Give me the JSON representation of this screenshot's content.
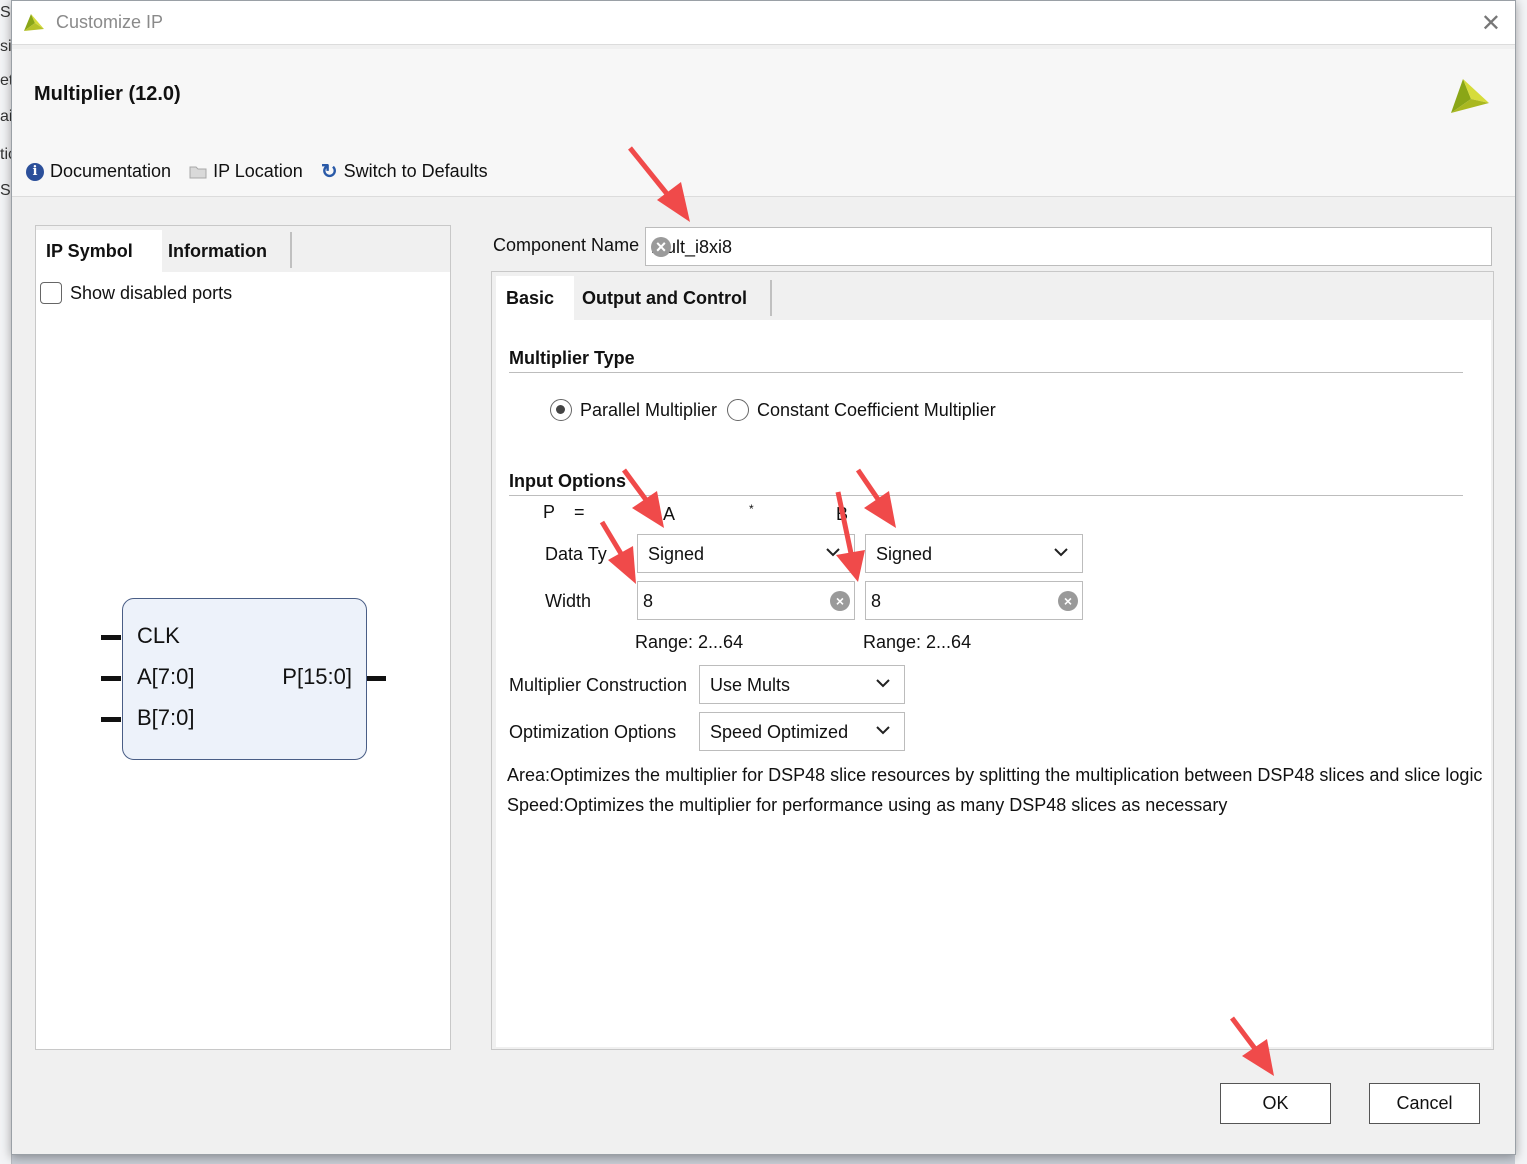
{
  "window": {
    "title": "Customize IP"
  },
  "header": {
    "heading": "Multiplier (12.0)",
    "toolbar": {
      "documentation": "Documentation",
      "ip_location": "IP Location",
      "switch_defaults": "Switch to Defaults"
    }
  },
  "left_panel": {
    "tabs": [
      "IP Symbol",
      "Information"
    ],
    "show_disabled_ports": "Show disabled ports",
    "symbol": {
      "inputs": [
        "CLK",
        "A[7:0]",
        "B[7:0]"
      ],
      "output": "P[15:0]"
    }
  },
  "component": {
    "label": "Component Name",
    "value": "mult_i8xi8"
  },
  "right_panel": {
    "tabs": [
      "Basic",
      "Output and Control"
    ],
    "multiplier_type": {
      "title": "Multiplier Type",
      "options": [
        "Parallel Multiplier",
        "Constant Coefficient Multiplier"
      ],
      "selected": "Parallel Multiplier"
    },
    "input_options": {
      "title": "Input Options",
      "p_label": "P",
      "equals": "=",
      "a_label": "A",
      "times": "*",
      "b_label": "B",
      "data_type_label": "Data Ty",
      "width_label": "Width",
      "a_data_type": "Signed",
      "b_data_type": "Signed",
      "a_width": "8",
      "b_width": "8",
      "a_range": "Range: 2...64",
      "b_range": "Range: 2...64"
    },
    "construction": {
      "label": "Multiplier Construction",
      "value": "Use Mults"
    },
    "optimization": {
      "label": "Optimization Options",
      "value": "Speed Optimized"
    },
    "notes": [
      "Area:Optimizes the multiplier for DSP48 slice resources by splitting the multiplication between DSP48 slices and slice logic",
      "Speed:Optimizes the multiplier for performance using as many DSP48 slices as necessary"
    ]
  },
  "buttons": {
    "ok": "OK",
    "cancel": "Cancel"
  },
  "colors": {
    "annotation_arrow": "#f04a4a",
    "brand_green": "#8aa617",
    "brand_yellow": "#d6dc3a"
  }
}
